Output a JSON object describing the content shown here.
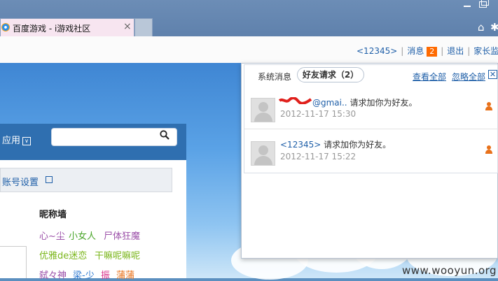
{
  "browser": {
    "tab_title": "百度游戏 - i游戏社区",
    "tab_close": "×",
    "home_icon": "⌂",
    "settings_icon": "✱"
  },
  "topnav": {
    "username": "<12345>",
    "messages_label": "消息",
    "messages_count": "2",
    "logout": "退出",
    "parental": "家长监"
  },
  "left": {
    "app_label": "应用",
    "app_chevron": "∨",
    "search_placeholder": "",
    "account_settings": "账号设置",
    "nick_wall_title": "昵称墙",
    "nick_rows": [
      [
        {
          "text": "心~尘",
          "color": "#9b4fa8"
        },
        {
          "text": "小女人",
          "color": "#4aa52a"
        },
        {
          "text": "尸体狂魔",
          "color": "#9b4fa8"
        }
      ],
      [
        {
          "text": "优雅de迷恋",
          "color": "#7bb61b"
        },
        {
          "text": "干嘛呢嘛呢",
          "color": "#7bb61b"
        }
      ],
      [
        {
          "text": "弑々神",
          "color": "#9b4fa8"
        },
        {
          "text": "梁-少",
          "color": "#2f7ad1"
        },
        {
          "text": "振",
          "color": "#d9318a"
        },
        {
          "text": "蒲蒲",
          "color": "#e8711a"
        }
      ]
    ]
  },
  "popup": {
    "tab_system": "系统消息",
    "tab_friend": "好友请求（2）",
    "view_all": "查看全部",
    "ignore_all": "忽略全部",
    "close": "✕",
    "requests": [
      {
        "sender": "@gmai..",
        "text": " 请求加你为好友。",
        "time": "2012-11-17 15:30"
      },
      {
        "sender": "<12345>",
        "text": " 请求加你为好友。",
        "time": "2012-11-17 15:22"
      }
    ]
  },
  "watermark": "www.wooyun.org",
  "colors": {
    "accent": "#1f5fa8",
    "badge": "#ff6a00",
    "header_blue": "#2f6fb0"
  }
}
